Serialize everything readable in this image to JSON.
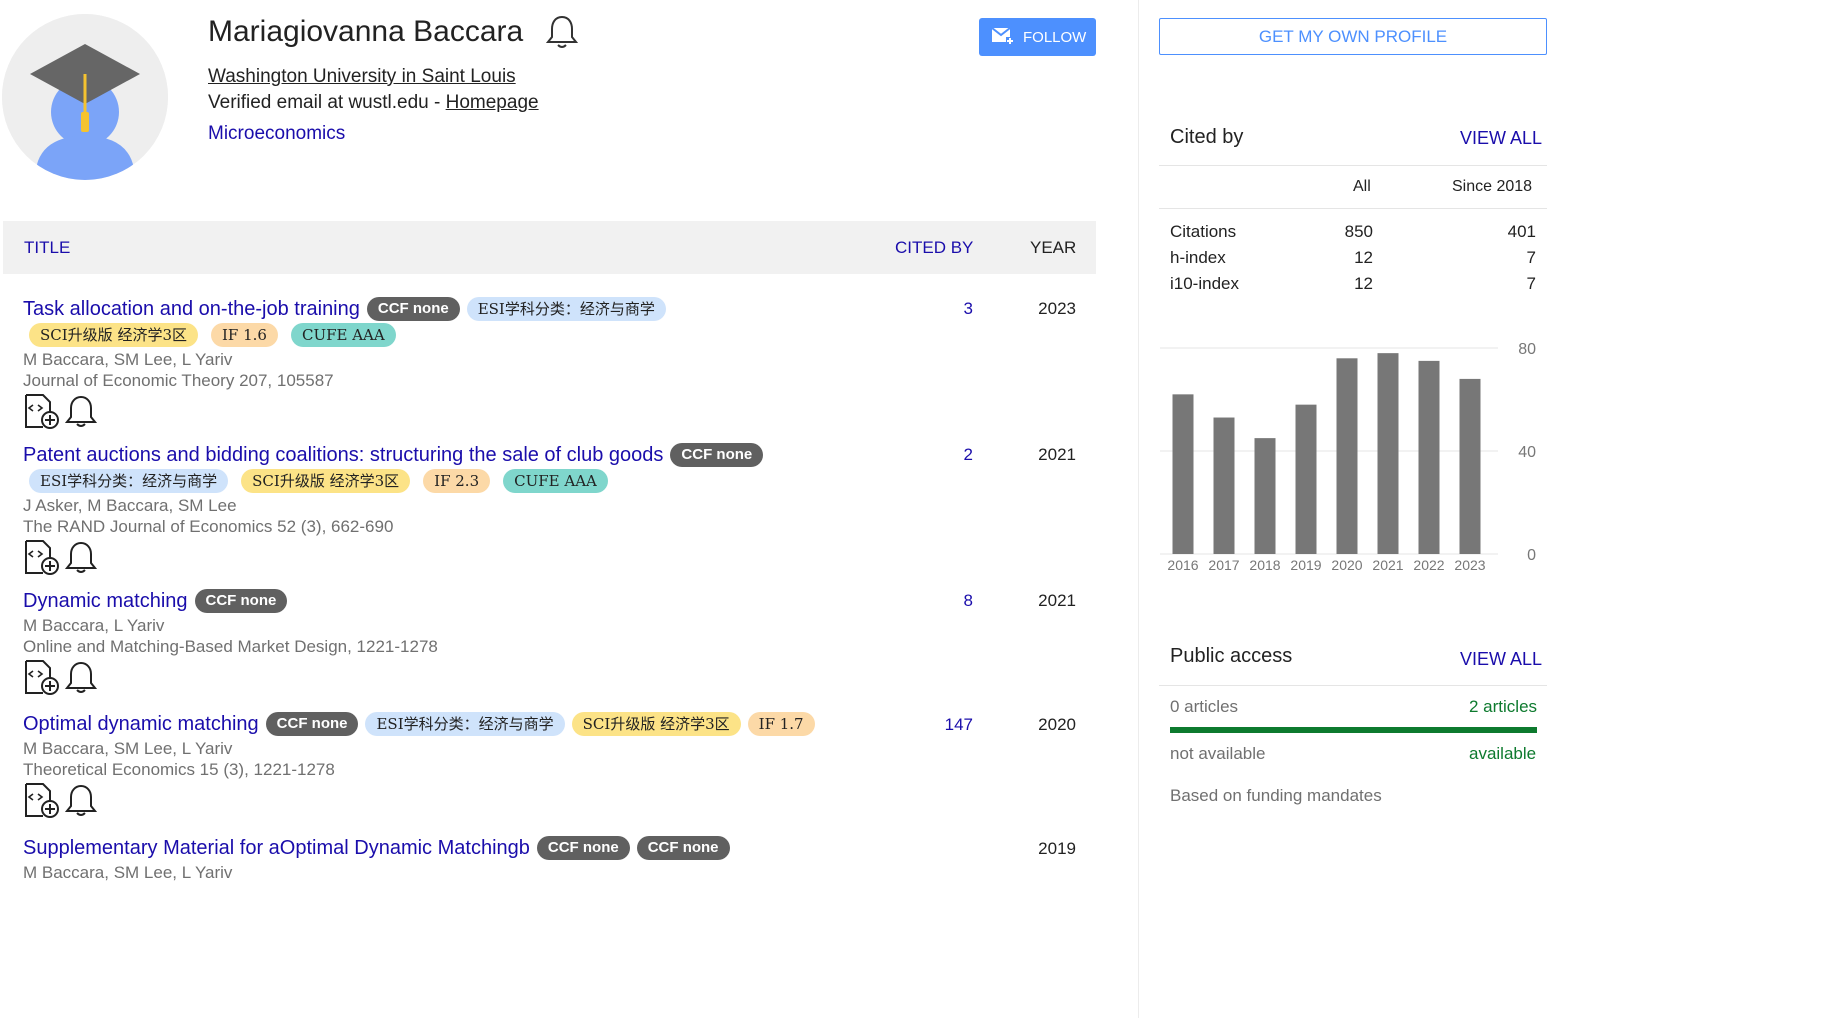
{
  "profile": {
    "name": "Mariagiovanna Baccara",
    "affiliation": "Washington University in Saint Louis",
    "email_prefix": "Verified email at wustl.edu - ",
    "homepage_label": "Homepage",
    "interest": "Microeconomics",
    "follow_label": "FOLLOW"
  },
  "table": {
    "title_header": "TITLE",
    "cited_header": "CITED BY",
    "year_header": "YEAR"
  },
  "articles": [
    {
      "title": "Task allocation and on-the-job training",
      "badges_line1": [
        "CCF none",
        "ESI学科分类：经济与商学"
      ],
      "badges_line2": [
        "SCI升级版 经济学3区",
        "IF 1.6",
        "CUFE AAA"
      ],
      "authors": "M Baccara, SM Lee, L Yariv",
      "venue": "Journal of Economic Theory 207, 105587",
      "cited": "3",
      "year": "2023"
    },
    {
      "title": "Patent auctions and bidding coalitions: structuring the sale of club goods",
      "badges_line1": [
        "CCF none"
      ],
      "badges_line2": [
        "ESI学科分类：经济与商学",
        "SCI升级版 经济学3区",
        "IF 2.3",
        "CUFE AAA"
      ],
      "authors": "J Asker, M Baccara, SM Lee",
      "venue": "The RAND Journal of Economics 52 (3), 662-690",
      "cited": "2",
      "year": "2021"
    },
    {
      "title": "Dynamic matching",
      "badges_line1": [
        "CCF none"
      ],
      "badges_line2": [],
      "authors": "M Baccara, L Yariv",
      "venue": "Online and Matching-Based Market Design, 1221-1278",
      "cited": "8",
      "year": "2021"
    },
    {
      "title": "Optimal dynamic matching",
      "badges_line1": [
        "CCF none",
        "ESI学科分类：经济与商学",
        "SCI升级版 经济学3区",
        "IF 1.7"
      ],
      "badges_line2": [],
      "authors": "M Baccara, SM Lee, L Yariv",
      "venue": "Theoretical Economics 15 (3), 1221-1278",
      "cited": "147",
      "year": "2020"
    },
    {
      "title": "Supplementary Material for aOptimal Dynamic Matchingb",
      "badges_line1": [
        "CCF none",
        "CCF none"
      ],
      "badges_line2": [],
      "authors": "M Baccara, SM Lee, L Yariv",
      "venue": "",
      "cited": "",
      "year": "2019"
    }
  ],
  "sidebar": {
    "own_profile_label": "GET MY OWN PROFILE",
    "cited_by_title": "Cited by",
    "view_all": "VIEW ALL",
    "col_all": "All",
    "col_since": "Since 2018",
    "metrics": [
      {
        "label": "Citations",
        "all": "850",
        "since": "401"
      },
      {
        "label": "h-index",
        "all": "12",
        "since": "7"
      },
      {
        "label": "i10-index",
        "all": "12",
        "since": "7"
      }
    ],
    "public_access_title": "Public access",
    "pa_left": "0 articles",
    "pa_right": "2 articles",
    "pa_left_status": "not available",
    "pa_right_status": "available",
    "pa_note": "Based on funding mandates",
    "pa_available_fraction": 1.0
  },
  "colors": {
    "link": "#1a0dab",
    "accent": "#4d90fe",
    "bar": "#777777",
    "available_green": "#0d7a2e"
  },
  "chart_data": {
    "type": "bar",
    "categories": [
      "2016",
      "2017",
      "2018",
      "2019",
      "2020",
      "2021",
      "2022",
      "2023"
    ],
    "values": [
      62,
      53,
      45,
      58,
      76,
      78,
      75,
      68
    ],
    "ylim": [
      0,
      80
    ],
    "yticks": [
      "80",
      "40",
      "0"
    ],
    "title": "",
    "xlabel": "",
    "ylabel": ""
  }
}
